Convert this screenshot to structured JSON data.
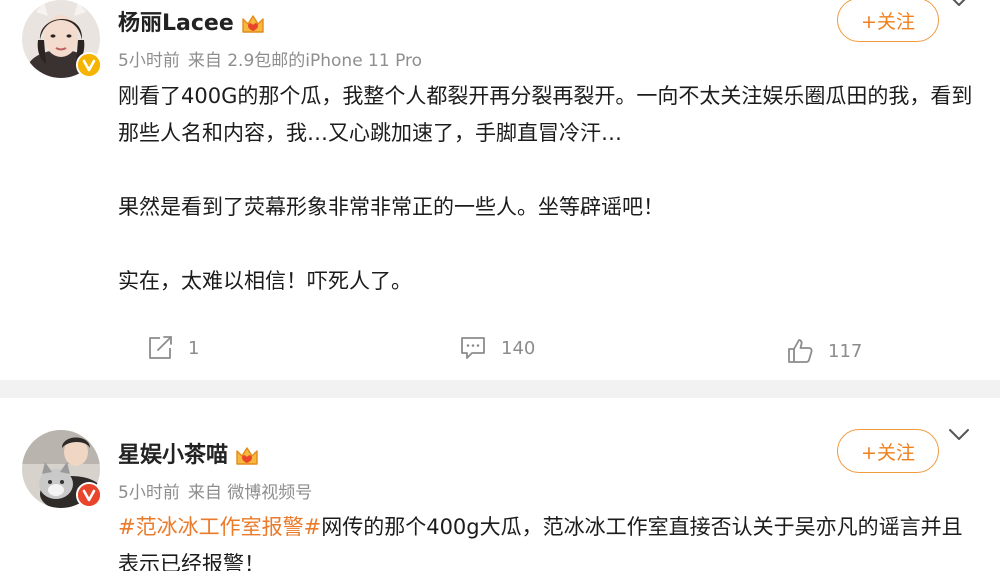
{
  "posts": [
    {
      "username": "杨丽Lacee",
      "time": "5小时前",
      "source": "来自 2.9包邮的iPhone 11 Pro",
      "follow_label": "+关注",
      "paragraphs": [
        "刚看了400G的那个瓜，我整个人都裂开再分裂再裂开。一向不太关注娱乐圈瓜田的我，看到那些人名和内容，我…又心跳加速了，手脚直冒冷汗…",
        "果然是看到了荧幕形象非常非常正的一些人。坐等辟谣吧！",
        "实在，太难以相信！吓死人了。"
      ],
      "repost_count": "1",
      "comment_count": "140",
      "like_count": "117",
      "verified_color": "#f5b400"
    },
    {
      "username": "星娱小茶喵",
      "time": "5小时前",
      "source": "来自 微博视频号",
      "follow_label": "+关注",
      "hashtag": "#范冰冰工作室报警#",
      "text": "网传的那个400g大瓜，范冰冰工作室直接否认关于吴亦凡的谣言并且表示已经报警！",
      "verified_color": "#e8452c"
    }
  ],
  "icons": {
    "repost": "repost-icon",
    "comment": "comment-icon",
    "like": "like-icon",
    "crown": "vip-crown-icon",
    "chevron": "chevron-down-icon"
  },
  "colors": {
    "accent": "#f07f1d",
    "hashtag": "#eb7b2a",
    "meta": "#8e8e8e",
    "separator": "#f2f2f2"
  }
}
